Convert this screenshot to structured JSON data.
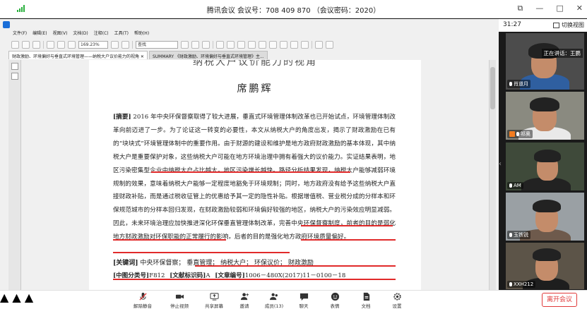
{
  "window": {
    "title": "腾讯会议 会议号：708 409 870 （会议密码：2020）",
    "controls": [
      "—",
      "□",
      "✕"
    ],
    "control_extra": "⧉"
  },
  "reader": {
    "menu": [
      "文件(F)",
      "编辑(E)",
      "视图(V)",
      "文档(D)",
      "注释(C)",
      "工具(T)",
      "帮助(H)"
    ],
    "zoom": "169.23%",
    "search_placeholder": "查找",
    "tabs": [
      "财政激励、环境偏好与垂直式环境管理——纳税大户议价能力的视角 ✕",
      "SUMMARY 《财政激励、环境偏好与垂直式环境管理》主..."
    ]
  },
  "paper": {
    "title_fragment": "纳税大户议价能力的视角",
    "author": "席鹏辉",
    "abstract_label": "[摘要]",
    "abstract_text": "2016 年中央环保督察取得了较大进展，垂直式环境管理体制改革也已开始试点，环境管理体制改革向前迈进了一步。为了论证这一转变的必要性，本文从纳税大户的角度出发，揭示了财政激励在已有的“块块式”环境管理体制中的重要作用。由于财源的建设和维护是地方政府财政激励的基本体现，其中纳税大户是重要保护对象，这些纳税大户可能在地方环境治理中拥有着强大的议价能力。实证结果表明，地区污染密集型企业中纳税大户占比越大，地区污染增长越快。路径分析结果发现，纳税大户能够减弱环境规制的效果，意味着纳税大户能够一定程度地豁免于环境规制；同时，地方政府没有给予这些纳税大户直接财政补贴，而是通过税收征管上的优惠给予其一定的隐性补贴。根据增值税、营业税分成的分样本和环保规范城市的分样本回归发现，在财政激励较弱和环境偏好较强的地区，纳税大户的污染效应明显减弱。因此，未来环境治理应加快推进深化环保垂直管理体制改革，完善中央环保督察制度，前者的目的是弱化地方财政激励对环保职能的正常履行的影响，后者的目的是强化地方政府环境质量偏好。",
    "keywords_label": "[关键词]",
    "keywords_text": "中央环保督察；  垂直管理；  纳税大户；  环保议价；  财政激励",
    "clc_label": "[中图分类号]",
    "clc_value": "F812",
    "doc_code_label": "[文献标识码]",
    "doc_code_value": "A",
    "article_no_label": "[文章编号]",
    "article_no_value": "1006－480X(2017)11－0100－18"
  },
  "side": {
    "time": "31:27",
    "switch_view": "切换视图",
    "speaking": "正在讲话：王鹏",
    "participants": [
      {
        "name": "肖道月"
      },
      {
        "name": "祁奥"
      },
      {
        "name": "AM"
      },
      {
        "name": "玉铁锐"
      },
      {
        "name": "XXH212"
      }
    ]
  },
  "bottom": {
    "controls": [
      "解除静音",
      "停止视频",
      "共享屏幕",
      "邀请",
      "成员(13)",
      "聊天",
      "表情",
      "文档",
      "设置"
    ],
    "leave": "离开会议"
  },
  "colors": {
    "annotation": "#e12a2a",
    "leave": "#e03a3a",
    "signal": "#2ab03d",
    "shield": "#1a6ed8"
  }
}
